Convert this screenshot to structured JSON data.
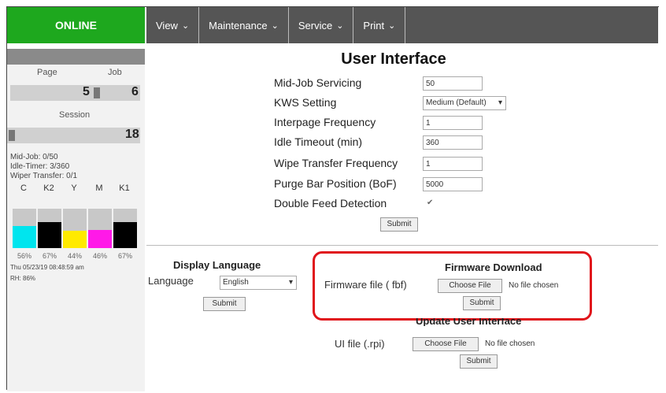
{
  "status": {
    "text": "ONLINE",
    "color": "#1ea81e"
  },
  "nav": {
    "items": [
      {
        "label": "View",
        "icon": "chevron-down-icon"
      },
      {
        "label": "Maintenance",
        "icon": "chevron-down-icon"
      },
      {
        "label": "Service",
        "icon": "chevron-down-icon"
      },
      {
        "label": "Print",
        "icon": "chevron-down-icon"
      }
    ]
  },
  "sidebar": {
    "page_label": "Page",
    "job_label": "Job",
    "page_value": "5",
    "job_value": "6",
    "session_label": "Session",
    "session_value": "18",
    "mid_job": "Mid-Job: 0/50",
    "idle_timer": "Idle-Timer: 3/360",
    "wiper_transfer": "Wiper Transfer: 0/1",
    "inks": [
      {
        "label": "C",
        "percent": "56%",
        "level": 0.56,
        "color": "#00e5ee"
      },
      {
        "label": "K2",
        "percent": "67%",
        "level": 0.67,
        "color": "#000000"
      },
      {
        "label": "Y",
        "percent": "44%",
        "level": 0.44,
        "color": "#ffea00"
      },
      {
        "label": "M",
        "percent": "46%",
        "level": 0.46,
        "color": "#ff19e8"
      },
      {
        "label": "K1",
        "percent": "67%",
        "level": 0.67,
        "color": "#000000"
      }
    ],
    "datetime": "Thu 05/23/19 08:48:59 am",
    "rh": "RH: 86%"
  },
  "main": {
    "title": "User Interface",
    "settings": {
      "mid_job_label": "Mid-Job Servicing",
      "mid_job_value": "50",
      "kws_label": "KWS Setting",
      "kws_value": "Medium (Default)",
      "interpage_label": "Interpage Frequency",
      "interpage_value": "1",
      "idle_label": "Idle Timeout (min)",
      "idle_value": "360",
      "wipe_label": "Wipe Transfer Frequency",
      "wipe_value": "1",
      "purge_label": "Purge Bar Position (BoF)",
      "purge_value": "5000",
      "double_feed_label": "Double Feed Detection",
      "double_feed_checked": true
    },
    "submit_label": "Submit"
  },
  "language": {
    "title": "Display Language",
    "label": "Language",
    "value": "English",
    "submit_label": "Submit"
  },
  "firmware": {
    "title": "Firmware Download",
    "label": "Firmware file ( fbf)",
    "choose_label": "Choose File",
    "no_file": "No file chosen",
    "submit_label": "Submit",
    "highlight_color": "#e0141b"
  },
  "update_ui": {
    "title": "Update User Interface",
    "label": "UI file (.rpi)",
    "choose_label": "Choose File",
    "no_file": "No file chosen",
    "submit_label": "Submit"
  }
}
